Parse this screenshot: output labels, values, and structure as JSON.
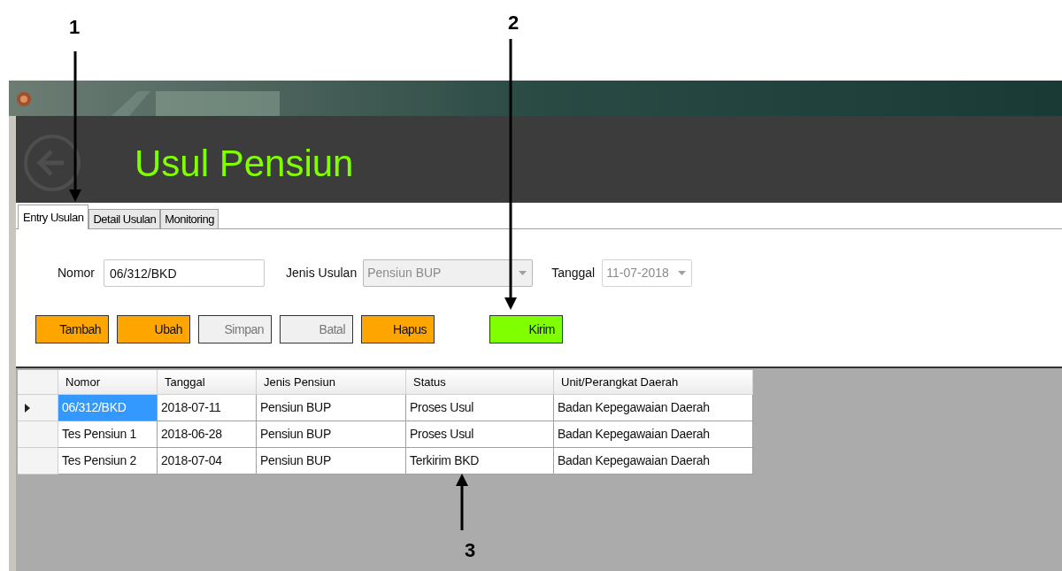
{
  "callouts": [
    {
      "label": "1"
    },
    {
      "label": "2"
    },
    {
      "label": "3"
    }
  ],
  "header": {
    "title": "Usul Pensiun"
  },
  "tabs": [
    {
      "label": "Entry Usulan",
      "selected": true
    },
    {
      "label": "Detail Usulan",
      "selected": false
    },
    {
      "label": "Monitoring",
      "selected": false
    }
  ],
  "form": {
    "nomor": {
      "label": "Nomor",
      "value": "06/312/BKD"
    },
    "jenis_usulan": {
      "label": "Jenis Usulan",
      "value": "Pensiun BUP",
      "disabled": true
    },
    "tanggal": {
      "label": "Tanggal",
      "value": "11-07-2018",
      "disabled": true
    }
  },
  "buttons": [
    {
      "label": "Tambah",
      "color": "#ffa500",
      "disabled": false
    },
    {
      "label": "Ubah",
      "color": "#ffa500",
      "disabled": false
    },
    {
      "label": "Simpan",
      "color": "#f0f0f0",
      "disabled": true
    },
    {
      "label": "Batal",
      "color": "#f0f0f0",
      "disabled": true
    },
    {
      "label": "Hapus",
      "color": "#ffa500",
      "disabled": false
    },
    {
      "label": "Kirim",
      "color": "#80ff00",
      "disabled": false
    }
  ],
  "table": {
    "columns": [
      "Nomor",
      "Tanggal",
      "Jenis Pensiun",
      "Status",
      "Unit/Perangkat Daerah"
    ],
    "rows": [
      {
        "selected": true,
        "cells": [
          "06/312/BKD",
          "2018-07-11",
          "Pensiun BUP",
          "Proses Usul",
          "Badan Kepegawaian Daerah"
        ]
      },
      {
        "selected": false,
        "cells": [
          "Tes Pensiun 1",
          "2018-06-28",
          "Pensiun BUP",
          "Proses Usul",
          "Badan Kepegawaian Daerah"
        ]
      },
      {
        "selected": false,
        "cells": [
          "Tes Pensiun 2",
          "2018-07-04",
          "Pensiun BUP",
          "Terkirim BKD",
          "Badan Kepegawaian Daerah"
        ]
      }
    ]
  }
}
